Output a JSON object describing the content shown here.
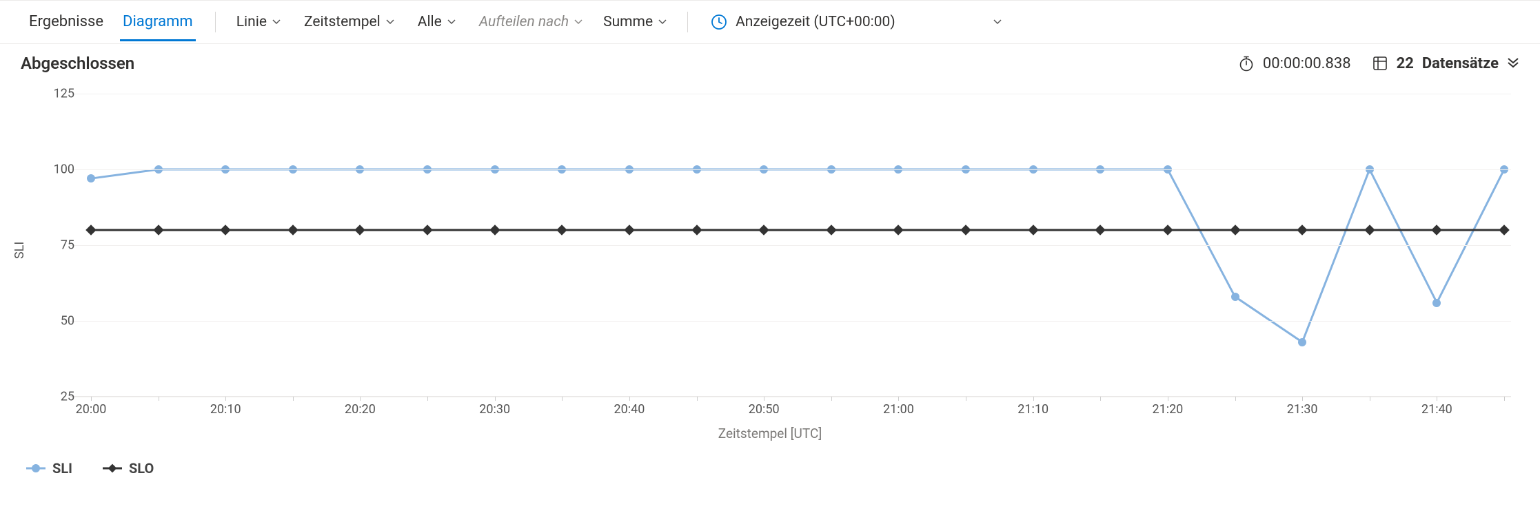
{
  "tabs": {
    "results": "Ergebnisse",
    "chart": "Diagramm"
  },
  "toolbar": {
    "chart_type": "Linie",
    "x_column": "Zeitstempel",
    "y_columns": "Alle",
    "split_by": "Aufteilen nach",
    "aggregation": "Summe",
    "time_label": "Anzeigezeit (UTC+00:00)"
  },
  "status": {
    "title": "Abgeschlossen",
    "duration": "00:00:00.838",
    "record_count": "22",
    "records_label": "Datensätze"
  },
  "legend": {
    "sli": "SLI",
    "slo": "SLO"
  },
  "chart_data": {
    "type": "line",
    "xlabel": "Zeitstempel [UTC]",
    "ylabel": "SLI",
    "ylim": [
      25,
      125
    ],
    "yticks": [
      25,
      50,
      75,
      100,
      125
    ],
    "x": [
      "20:00",
      "20:05",
      "20:10",
      "20:15",
      "20:20",
      "20:25",
      "20:30",
      "20:35",
      "20:40",
      "20:45",
      "20:50",
      "20:55",
      "21:00",
      "21:05",
      "21:10",
      "21:15",
      "21:20",
      "21:25",
      "21:30",
      "21:35",
      "21:40",
      "21:45"
    ],
    "xtick_labels": [
      "20:00",
      "20:10",
      "20:20",
      "20:30",
      "20:40",
      "20:50",
      "21:00",
      "21:10",
      "21:20",
      "21:30",
      "21:40"
    ],
    "series": [
      {
        "name": "SLI",
        "color": "#86b3e0",
        "marker": "circle",
        "values": [
          97,
          100,
          100,
          100,
          100,
          100,
          100,
          100,
          100,
          100,
          100,
          100,
          100,
          100,
          100,
          100,
          100,
          58,
          43,
          100,
          56,
          100
        ]
      },
      {
        "name": "SLO",
        "color": "#333333",
        "marker": "diamond",
        "values": [
          80,
          80,
          80,
          80,
          80,
          80,
          80,
          80,
          80,
          80,
          80,
          80,
          80,
          80,
          80,
          80,
          80,
          80,
          80,
          80,
          80,
          80
        ]
      }
    ]
  }
}
